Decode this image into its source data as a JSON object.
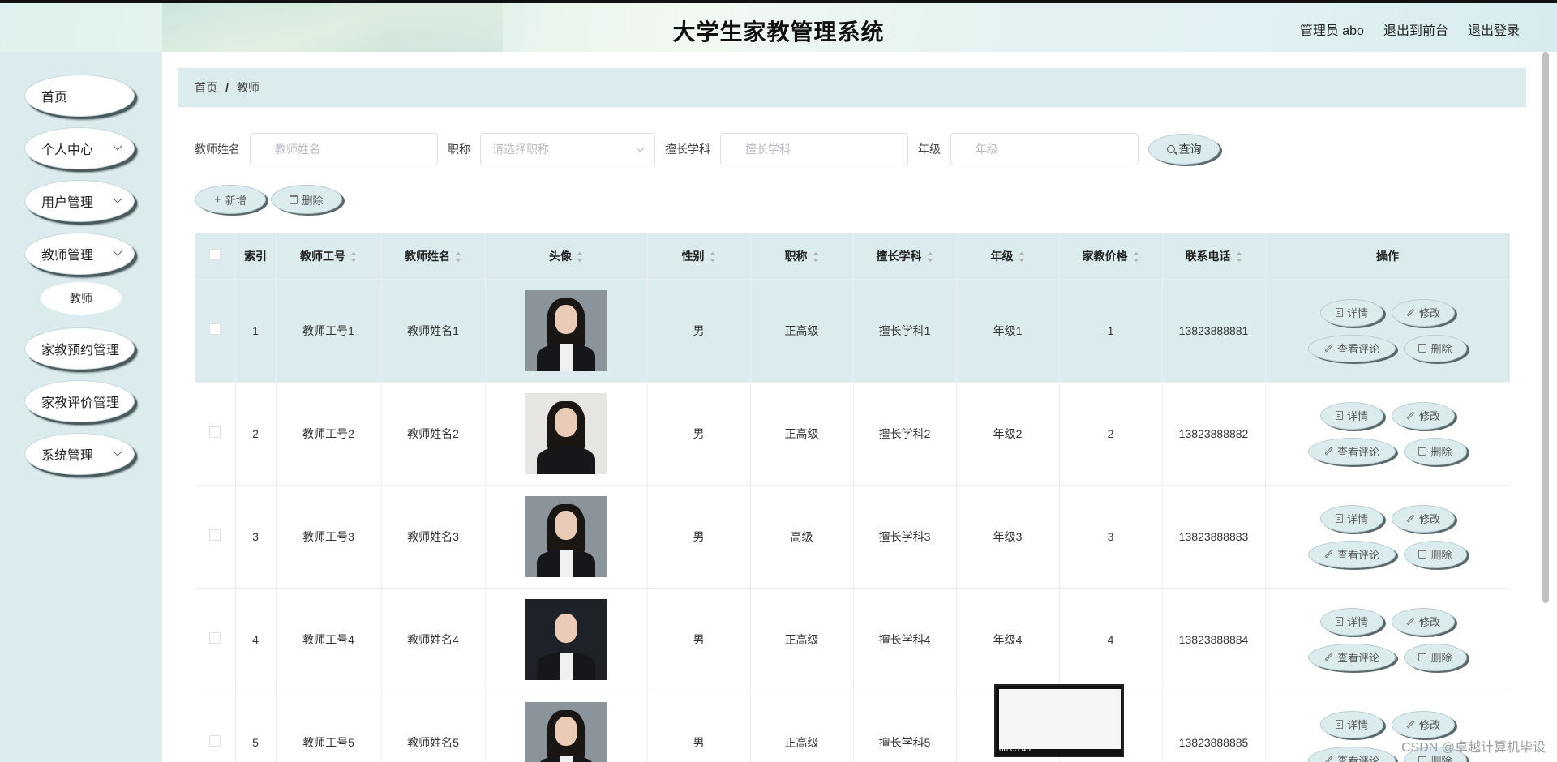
{
  "header": {
    "title": "大学生家教管理系统",
    "links": [
      "管理员 abo",
      "退出到前台",
      "退出登录"
    ]
  },
  "sidebar": {
    "items": [
      {
        "label": "首页",
        "has_children": false
      },
      {
        "label": "个人中心",
        "has_children": true
      },
      {
        "label": "用户管理",
        "has_children": true
      },
      {
        "label": "教师管理",
        "has_children": true
      },
      {
        "label": "家教预约管理",
        "has_children": false
      },
      {
        "label": "家教评价管理",
        "has_children": false
      },
      {
        "label": "系统管理",
        "has_children": true
      }
    ],
    "sub_item": "教师"
  },
  "breadcrumb": {
    "home": "首页",
    "sep": "/",
    "current": "教师"
  },
  "search": {
    "name_label": "教师姓名",
    "name_placeholder": "教师姓名",
    "title_label": "职称",
    "title_placeholder": "请选择职称",
    "subject_label": "擅长学科",
    "subject_placeholder": "擅长学科",
    "grade_label": "年级",
    "grade_placeholder": "年级",
    "query_button": "查询"
  },
  "actions": {
    "add": "新增",
    "delete": "删除"
  },
  "table": {
    "headers": [
      "索引",
      "教师工号",
      "教师姓名",
      "头像",
      "性别",
      "职称",
      "擅长学科",
      "年级",
      "家教价格",
      "联系电话",
      "操作"
    ],
    "rows": [
      {
        "index": "1",
        "id": "教师工号1",
        "name": "教师姓名1",
        "gender": "男",
        "title": "正高级",
        "subject": "擅长学科1",
        "grade": "年级1",
        "price": "1",
        "phone": "13823888881"
      },
      {
        "index": "2",
        "id": "教师工号2",
        "name": "教师姓名2",
        "gender": "男",
        "title": "正高级",
        "subject": "擅长学科2",
        "grade": "年级2",
        "price": "2",
        "phone": "13823888882"
      },
      {
        "index": "3",
        "id": "教师工号3",
        "name": "教师姓名3",
        "gender": "男",
        "title": "高级",
        "subject": "擅长学科3",
        "grade": "年级3",
        "price": "3",
        "phone": "13823888883"
      },
      {
        "index": "4",
        "id": "教师工号4",
        "name": "教师姓名4",
        "gender": "男",
        "title": "正高级",
        "subject": "擅长学科4",
        "grade": "年级4",
        "price": "4",
        "phone": "13823888884"
      },
      {
        "index": "5",
        "id": "教师工号5",
        "name": "教师姓名5",
        "gender": "男",
        "title": "正高级",
        "subject": "擅长学科5",
        "grade": "",
        "price": "",
        "phone": "13823888885"
      }
    ],
    "ops": {
      "detail": "详情",
      "edit": "修改",
      "review": "查看评论",
      "delete": "删除"
    }
  },
  "overlay": {
    "video_time": "00:05:46",
    "watermark": "CSDN @卓越计算机毕设"
  },
  "colors": {
    "accent_bg": "#dcecee",
    "sidebar_bg": "#dcecee",
    "pill_shadow": "#5a686c"
  }
}
